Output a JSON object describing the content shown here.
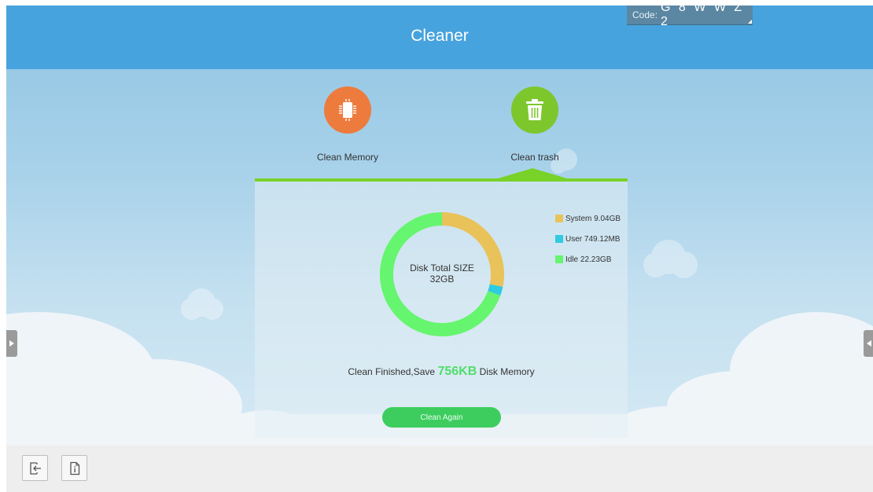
{
  "header": {
    "title": "Cleaner",
    "code_label": "Code:",
    "code_value": "G 8 W W Z 2"
  },
  "functions": [
    {
      "label": "Clean Memory",
      "icon": "chip-icon",
      "color": "#ed7b3d"
    },
    {
      "label": "Clean trash",
      "icon": "trash-icon",
      "color": "#7dc72d"
    }
  ],
  "disk": {
    "center_line1": "Disk Total SIZE",
    "center_line2": "32GB",
    "legend": [
      {
        "label": "System 9.04GB",
        "color": "#e9c25a"
      },
      {
        "label": "User 749.12MB",
        "color": "#2fcbe0"
      },
      {
        "label": "Idle 22.23GB",
        "color": "#66f56f"
      }
    ]
  },
  "chart_data": {
    "type": "pie",
    "subtype": "donut",
    "title": "",
    "center_label": "Disk Total SIZE 32GB",
    "series": [
      {
        "name": "System",
        "value": 9.04,
        "unit": "GB",
        "color": "#e9c25a"
      },
      {
        "name": "User",
        "value": 0.749,
        "unit": "GB",
        "color": "#2fcbe0"
      },
      {
        "name": "Idle",
        "value": 22.23,
        "unit": "GB",
        "color": "#66f56f"
      }
    ],
    "legend_position": "right"
  },
  "status": {
    "prefix": "Clean Finished,Save ",
    "amount": "756KB",
    "suffix": " Disk Memory"
  },
  "actions": {
    "clean_again": "Clean Again"
  },
  "bottom_bar": {
    "buttons": [
      {
        "icon": "exit-icon"
      },
      {
        "icon": "info-icon"
      }
    ]
  }
}
